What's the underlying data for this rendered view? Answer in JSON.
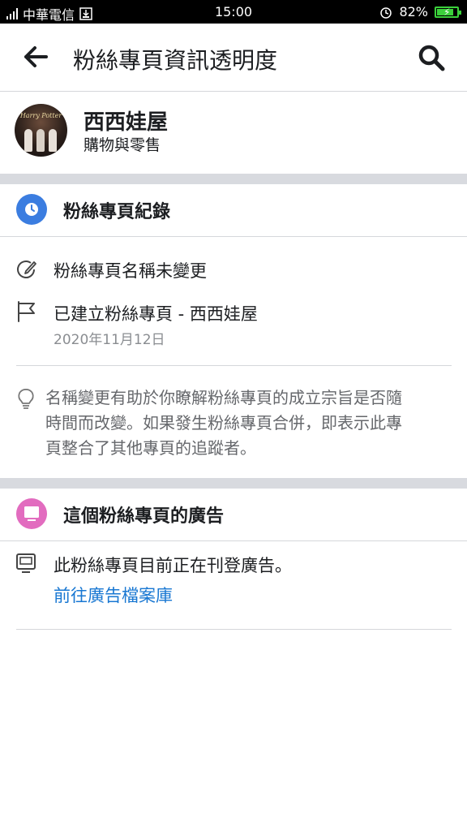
{
  "status_bar": {
    "carrier": "中華電信",
    "time": "15:00",
    "battery": "82%",
    "battery_level": 0.82
  },
  "header": {
    "title": "粉絲專頁資訊透明度"
  },
  "profile": {
    "name": "西西娃屋",
    "category": "購物與零售",
    "avatar_logo_text": "Harry Potter"
  },
  "history": {
    "title": "粉絲專頁紀錄",
    "name_change": "粉絲專頁名稱未變更",
    "created": "已建立粉絲專頁 - 西西娃屋",
    "created_date": "2020年11月12日",
    "info_lines": [
      "名稱變更有助於你瞭解粉絲專頁的成立宗旨是否隨",
      "時間而改變。如果發生粉絲專頁合併，即表示此專",
      "頁整合了其他專頁的追蹤者。"
    ]
  },
  "ads": {
    "title": "這個粉絲專頁的廣告",
    "status": "此粉絲專頁目前正在刊登廣告。",
    "link": "前往廣告檔案庫"
  },
  "colors": {
    "history_icon": "#3b7de0",
    "ads_icon": "#e26cbf",
    "link": "#1877d2",
    "battery": "#3bd13b"
  }
}
